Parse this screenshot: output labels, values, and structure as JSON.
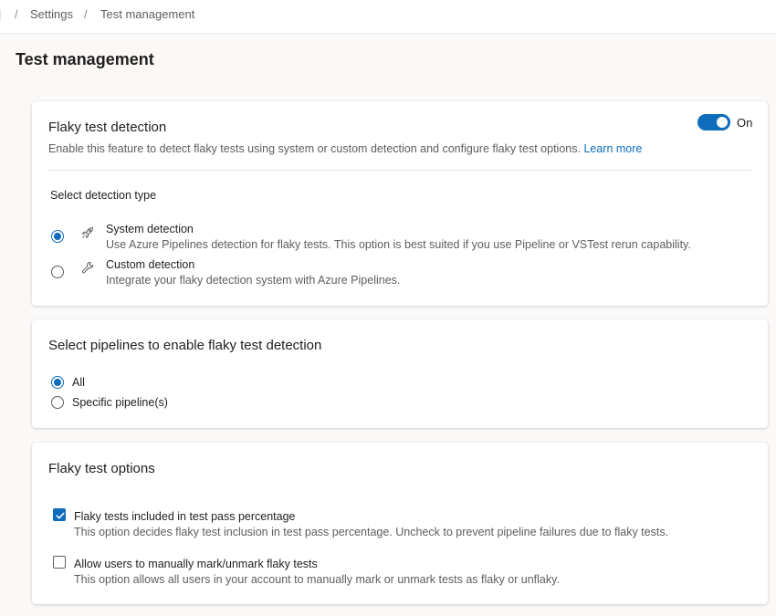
{
  "breadcrumb": {
    "items": [
      "Settings",
      "Test management"
    ]
  },
  "page": {
    "title": "Test management"
  },
  "detection_card": {
    "title": "Flaky test detection",
    "description": "Enable this feature to detect flaky tests using system or custom detection and configure flaky test options.",
    "learn_more": "Learn more",
    "toggle": {
      "label": "On",
      "state": true
    },
    "section_label": "Select detection type",
    "options": [
      {
        "icon": "rocket-icon",
        "title": "System detection",
        "description": "Use Azure Pipelines detection for flaky tests. This option is best suited if you use Pipeline or VSTest rerun capability.",
        "selected": true
      },
      {
        "icon": "wrench-icon",
        "title": "Custom detection",
        "description": "Integrate your flaky detection system with Azure Pipelines.",
        "selected": false
      }
    ]
  },
  "pipelines_card": {
    "title": "Select pipelines to enable flaky test detection",
    "options": [
      {
        "label": "All",
        "selected": true
      },
      {
        "label": "Specific pipeline(s)",
        "selected": false
      }
    ]
  },
  "options_card": {
    "title": "Flaky test options",
    "options": [
      {
        "title": "Flaky tests included in test pass percentage",
        "description": "This option decides flaky test inclusion in test pass percentage. Uncheck to prevent pipeline failures due to flaky tests.",
        "checked": true
      },
      {
        "title": "Allow users to manually mark/unmark flaky tests",
        "description": "This option allows all users in your account to manually mark or unmark tests as flaky or unflaky.",
        "checked": false
      }
    ]
  },
  "colors": {
    "accent": "#0f6cbd",
    "text_primary": "#201f1e",
    "text_secondary": "#605e5c",
    "page_background": "#faf9f8"
  }
}
